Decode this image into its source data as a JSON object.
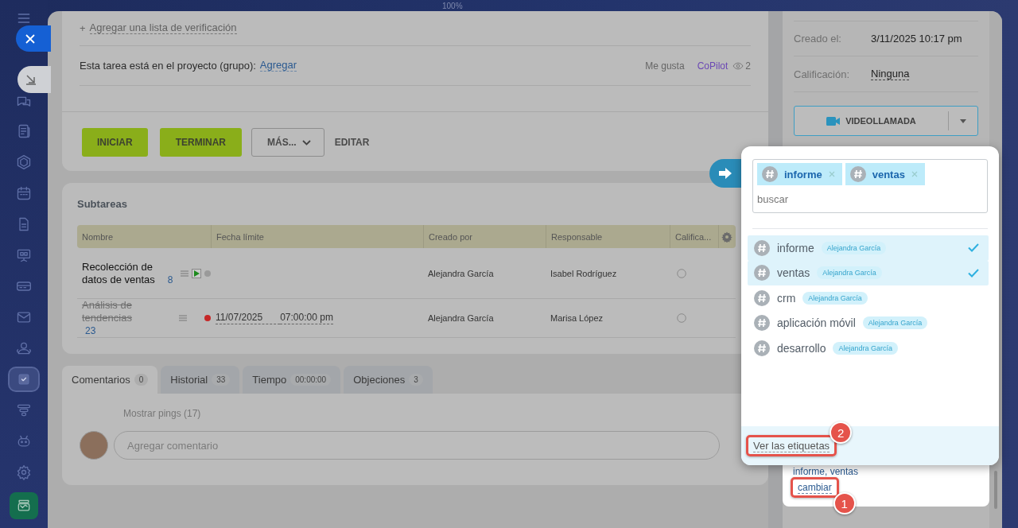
{
  "top_bar": {
    "zoom": "100%"
  },
  "sidebar": {
    "items": [
      {
        "selected": false
      },
      {
        "selected": false
      },
      {
        "selected": false
      },
      {
        "selected": false
      },
      {
        "selected": false
      },
      {
        "selected": false
      },
      {
        "selected": false
      },
      {
        "selected": false
      },
      {
        "selected": false
      },
      {
        "selected": false
      },
      {
        "selected": true
      },
      {
        "selected": false
      },
      {
        "selected": false
      },
      {
        "selected": false
      },
      {
        "selected": false
      }
    ]
  },
  "task": {
    "checklist_add": {
      "icon": "+",
      "label": "Agregar una lista de verificación"
    },
    "project": {
      "label": "Esta tarea está en el proyecto (grupo):",
      "link": "Agregar"
    },
    "likes": "Me gusta",
    "copilot": "CoPilot",
    "views": "2",
    "actions": [
      {
        "label": "INICIAR",
        "kind": "primary"
      },
      {
        "label": "TERMINAR",
        "kind": "primary"
      },
      {
        "label": "MÁS...",
        "kind": "menu"
      },
      {
        "label": "EDITAR",
        "kind": "link"
      }
    ]
  },
  "subtasks": {
    "title": "Subtareas",
    "columns": [
      "Nombre",
      "Fecha límite",
      "Creado por",
      "Responsable",
      "Califica..."
    ],
    "rows": [
      {
        "name": "Recolección de datos de ventas",
        "count": "8",
        "completed": false,
        "startable": true,
        "color": "#9a9a9a",
        "created_by": "Alejandra García",
        "responsible": "Isabel Rodríguez"
      },
      {
        "name": "Análisis de tendencias",
        "count": "23",
        "completed": true,
        "startable": false,
        "color": "#c62828",
        "deadline": {
          "date": "11/07/2025",
          "time": "07:00:00 pm"
        },
        "created_by": "Alejandra García",
        "responsible": "Marisa López"
      }
    ]
  },
  "tabs": [
    {
      "label": "Comentarios",
      "count": "0",
      "selected": true
    },
    {
      "label": "Historial",
      "count": "33",
      "selected": false
    },
    {
      "label": "Tiempo",
      "count": "00:00:00",
      "selected": false
    },
    {
      "label": "Objeciones",
      "count": "3",
      "selected": false
    }
  ],
  "comments": {
    "pings": "Mostrar pings (17)",
    "placeholder": "Agregar comentario"
  },
  "details": {
    "fields": [
      {
        "label": "Creado el:",
        "value": "3/11/2025 10:17 pm",
        "kind": "text"
      },
      {
        "label": "Calificación:",
        "value": "Ninguna",
        "kind": "link"
      }
    ],
    "video_call": "VIDEOLLAMADA",
    "tags": {
      "value": "informe, ventas",
      "action": {
        "label": "cambiar",
        "callout": "1"
      }
    }
  },
  "tag_popup": {
    "chips": [
      {
        "label": "informe"
      },
      {
        "label": "ventas"
      }
    ],
    "placeholder": "buscar",
    "options": [
      {
        "label": "informe",
        "owner": "Alejandra García",
        "selected": true
      },
      {
        "label": "ventas",
        "owner": "Alejandra García",
        "selected": true
      },
      {
        "label": "crm",
        "owner": "Alejandra García",
        "selected": false
      },
      {
        "label": "aplicación móvil",
        "owner": "Alejandra García",
        "selected": false
      },
      {
        "label": "desarrollo",
        "owner": "Alejandra García",
        "selected": false
      }
    ],
    "footer": {
      "label": "Ver las etiquetas",
      "callout": "2"
    }
  }
}
